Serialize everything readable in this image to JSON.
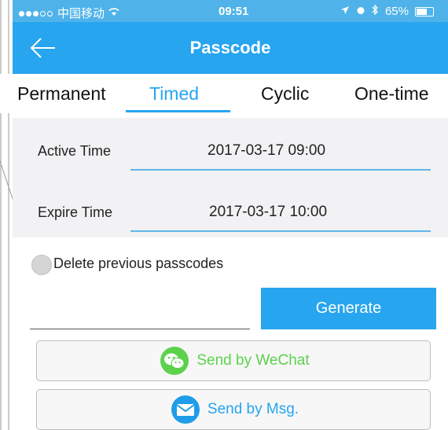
{
  "status_bar": {
    "carrier": "中国移动",
    "time": "09:51",
    "battery": "65%"
  },
  "header": {
    "title": "Passcode",
    "back_icon": "arrow-left-icon"
  },
  "tabs": [
    {
      "label": "Permanent",
      "active": false
    },
    {
      "label": "Timed",
      "active": true
    },
    {
      "label": "Cyclic",
      "active": false
    },
    {
      "label": "One-time",
      "active": false
    }
  ],
  "form": {
    "active_time_label": "Active Time",
    "active_time_value": "2017-03-17 09:00",
    "expire_time_label": "Expire Time",
    "expire_time_value": "2017-03-17 10:00"
  },
  "options": {
    "delete_previous_label": "Delete previous passcodes",
    "delete_previous_checked": false
  },
  "generate": {
    "code_value": "",
    "button_label": "Generate"
  },
  "share": {
    "wechat_label": "Send by WeChat",
    "wechat_icon": "wechat-icon",
    "msg_label": "Send by Msg.",
    "msg_icon": "envelope-icon"
  },
  "colors": {
    "accent": "#27a5ef",
    "status_bar": "#4fb3e9",
    "wechat_green": "#5cd24c",
    "panel_bg": "#f2f2f4"
  }
}
